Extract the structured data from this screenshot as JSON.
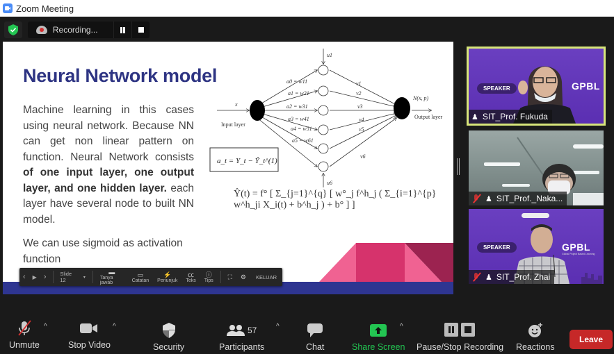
{
  "window": {
    "title": "Zoom Meeting"
  },
  "topbar": {
    "security_badge": "shield-check-icon",
    "recording_label": "Recording...",
    "pause_icon": "pause-icon",
    "stop_icon": "stop-icon"
  },
  "slide": {
    "title": "Neural Network model",
    "body_1": "Machine learning in this cases using neural network. Because NN can get non linear pattern on function. Neural Network consists ",
    "body_bold": "of one input layer, one output layer, and one hidden layer.",
    "body_2": " each layer have several node to built NN model.",
    "body_3": "We can use sigmoid as activation function",
    "diagram": {
      "input_label": "x",
      "input_layer": "Input layer",
      "output_label": "N(x, p)",
      "output_layer": "Output layer",
      "top_bias": "u1",
      "bottom_bias": "u6",
      "weights": [
        "a0 = w11",
        "a1 = w21",
        "a2 = w31",
        "a3 = w41",
        "a4 = w51",
        "a5 = w61"
      ],
      "out_weights": [
        "v1",
        "v2",
        "v3",
        "v4",
        "v5",
        "v6"
      ],
      "residual_formula": "a_t = Y_t − Ŷ_t^(1)",
      "main_formula": "Ŷ(t) = f° [ Σ_{j=1}^{q} [ w°_j f^h_j ( Σ_{i=1}^{p} w^h_ji X_i(t) + b^h_j ) + b° ] ]"
    }
  },
  "presenter_bar": {
    "prev": "‹",
    "play": "▶",
    "next": "›",
    "slide_label": "Slide 12",
    "items": [
      {
        "label": "Tanya jawab",
        "icon": "qa-icon"
      },
      {
        "label": "Catatan",
        "icon": "notes-icon"
      },
      {
        "label": "Penunjuk",
        "icon": "laser-pointer-icon"
      },
      {
        "label": "Teks",
        "icon": "captions-icon"
      },
      {
        "label": "Tips",
        "icon": "info-icon"
      }
    ],
    "exit_label": "KELUAR"
  },
  "participants": [
    {
      "name": "SIT_Prof. Fukuda",
      "active_speaker": true,
      "muted": false,
      "badge": "SPEAKER",
      "brand": "GPBL"
    },
    {
      "name": "SIT_Prof._Naka...",
      "active_speaker": false,
      "muted": true
    },
    {
      "name": "SIT_Prof. Zhai",
      "active_speaker": false,
      "muted": true,
      "badge": "SPEAKER",
      "brand": "GPBL",
      "brand_sub": "Global Project Based Learning"
    }
  ],
  "toolbar": {
    "unmute": "Unmute",
    "stop_video": "Stop Video",
    "security": "Security",
    "participants": "Participants",
    "participant_count": "57",
    "chat": "Chat",
    "share_screen": "Share Screen",
    "pause_stop_recording": "Pause/Stop Recording",
    "reactions": "Reactions",
    "leave": "Leave"
  },
  "colors": {
    "slide_title": "#2e3483",
    "slide_band": "#2e3591",
    "active_speaker_border": "#d8e67a",
    "share_green": "#23c552",
    "leave_red": "#c62828"
  }
}
